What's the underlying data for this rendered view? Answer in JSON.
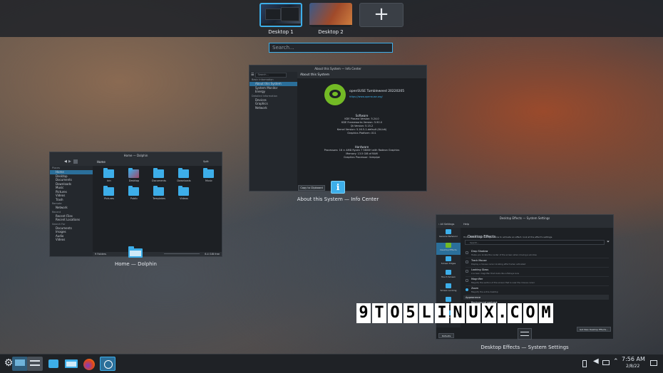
{
  "desktops": [
    {
      "label": "Desktop 1",
      "active": true
    },
    {
      "label": "Desktop 2",
      "active": false
    }
  ],
  "add_desktop": "+",
  "search": {
    "placeholder": "Search..."
  },
  "info_center": {
    "titlebar": "About this System — Info Center",
    "caption": "About this System — Info Center",
    "page_title": "About this System",
    "search_placeholder": "Search...",
    "sidebar": {
      "section1": "Basic Information",
      "items1": [
        "About this System",
        "System Monitor",
        "Energy"
      ],
      "section2": "Detailed Information",
      "items2": [
        "Devices",
        "Graphics",
        "Network"
      ]
    },
    "distro": "openSUSE Tumbleweed 20220205",
    "url": "https://www.opensuse.org/",
    "software_heading": "Software",
    "software": [
      "KDE Plasma Version: 5.24.0",
      "KDE Frameworks Version: 5.90.0",
      "Qt Version: 5.15.2",
      "Kernel Version: 5.16.5-1-default (64-bit)",
      "Graphics Platform: X11"
    ],
    "hardware_heading": "Hardware",
    "hardware": [
      "Processors: 16 × AMD Ryzen 7 5800H with Radeon Graphics",
      "Memory: 13.5 GiB of RAM",
      "Graphics Processor: llvmpipe"
    ],
    "copy_button": "Copy to Clipboard"
  },
  "dolphin": {
    "titlebar": "Home — Dolphin",
    "caption": "Home — Dolphin",
    "location": "Home",
    "split_label": "Split",
    "places_heading": "Places",
    "places": [
      "Home",
      "Desktop",
      "Documents",
      "Downloads",
      "Music",
      "Pictures",
      "Videos",
      "Trash"
    ],
    "remote_heading": "Remote",
    "remote": [
      "Network"
    ],
    "recent_heading": "Recent",
    "recent": [
      "Recent Files",
      "Recent Locations"
    ],
    "search_heading": "Search For",
    "search_for": [
      "Documents",
      "Images",
      "Audio",
      "Videos"
    ],
    "folders": [
      "bin",
      "Desktop",
      "Documents",
      "Downloads",
      "Music",
      "Pictures",
      "Public",
      "Templates",
      "Videos"
    ],
    "status_left": "9 Folders",
    "status_right": "6.4 GiB free"
  },
  "settings": {
    "titlebar": "Desktop Effects — System Settings",
    "caption": "Desktop Effects — System Settings",
    "nav_back": "All Settings",
    "nav_help": "Help",
    "page_title": "Desktop Effects",
    "description": "Hint: To find out or configure how to activate an effect, look at the effect's settings.",
    "search_placeholder": "Search...",
    "categories": [
      "General Behavior",
      "Desktop Effects",
      "Screen Edges",
      "Touch Screen",
      "Screen Locking",
      "Virtual Desktops",
      "Activities"
    ],
    "effects": [
      {
        "title": "Drop Shadow",
        "subtitle": "Helps you locate the center of the screen when moving a window"
      },
      {
        "title": "Track Mouse",
        "subtitle": "Display a mouse cursor locating effect when activated"
      },
      {
        "title": "Looking Glass",
        "subtitle": "A screen magnifier that looks like a fisheye lens"
      },
      {
        "title": "Magnifier",
        "subtitle": "Magnify the section of the screen that is near the mouse cursor"
      },
      {
        "title": "Zoom",
        "subtitle": "Magnify the entire desktop"
      }
    ],
    "appearance_heading": "Appearance",
    "appearance_item": "Background contrast",
    "defaults_button": "Defaults",
    "get_new_button": "Get New Desktop Effects..."
  },
  "watermark": "9TO5LINUX.COM",
  "clock": {
    "time": "7:56 AM",
    "date": "2/8/22"
  },
  "colors": {
    "accent": "#3daee9",
    "suse_green": "#73ba25"
  }
}
